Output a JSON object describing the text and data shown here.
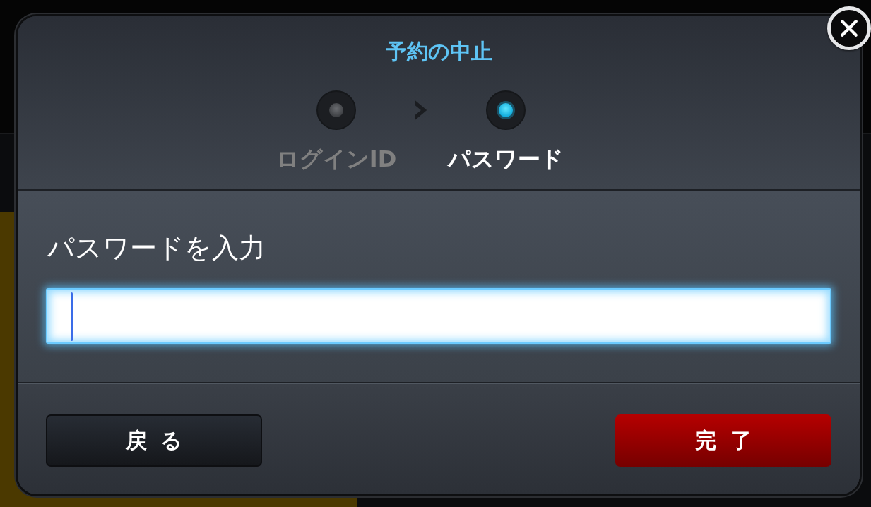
{
  "dialog": {
    "title": "予約の中止"
  },
  "steps": [
    {
      "label": "ログインID",
      "selected": false
    },
    {
      "label": "パスワード",
      "selected": true
    }
  ],
  "password_field": {
    "label": "パスワードを入力",
    "focused": true
  },
  "buttons": [
    {
      "label": "戻る",
      "kind": "secondary"
    },
    {
      "label": "完了",
      "kind": "primary"
    }
  ]
}
